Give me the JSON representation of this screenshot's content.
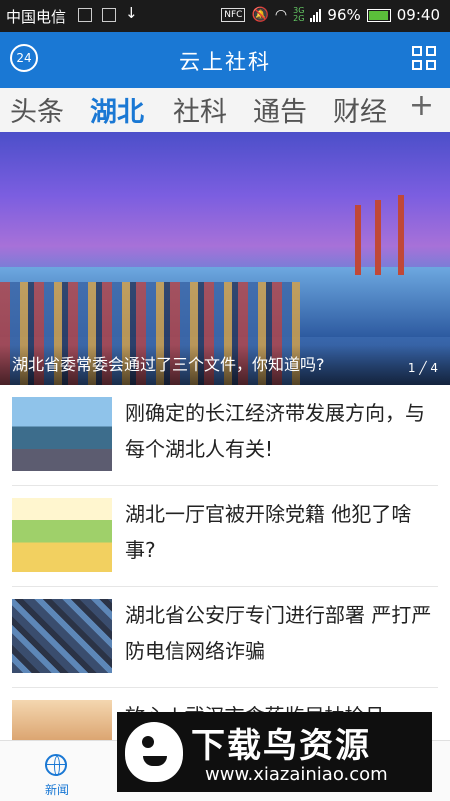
{
  "status_bar": {
    "carrier": "中国电信",
    "nfc": "NFC",
    "network": [
      "3G",
      "2G"
    ],
    "battery": "96%",
    "time": "09:40"
  },
  "header": {
    "badge": "24",
    "title": "云上社科",
    "grid_icon": "grid-icon"
  },
  "tabs": [
    {
      "label": "头条"
    },
    {
      "label": "湖北",
      "active": true
    },
    {
      "label": "社科"
    },
    {
      "label": "通告"
    },
    {
      "label": "财经"
    }
  ],
  "tabs_more": "+",
  "hero": {
    "caption": "湖北省委常委会通过了三个文件，你知道吗?",
    "page_current": "1",
    "page_total": "4"
  },
  "news": [
    {
      "title": "刚确定的长江经济带发展方向，与每个湖北人有关!"
    },
    {
      "title": "湖北一厅官被开除党籍  他犯了啥事?"
    },
    {
      "title": "湖北省公安厅专门进行部署 严打严防电信网络诈骗"
    },
    {
      "title": "放心 | 武汉市食药监局抽检月"
    }
  ],
  "bottom_nav": {
    "items": [
      {
        "label": "新闻",
        "icon": "globe-icon",
        "active": true
      }
    ]
  },
  "watermark": {
    "title": "下载鸟资源",
    "url": "www.xiazainiao.com"
  }
}
